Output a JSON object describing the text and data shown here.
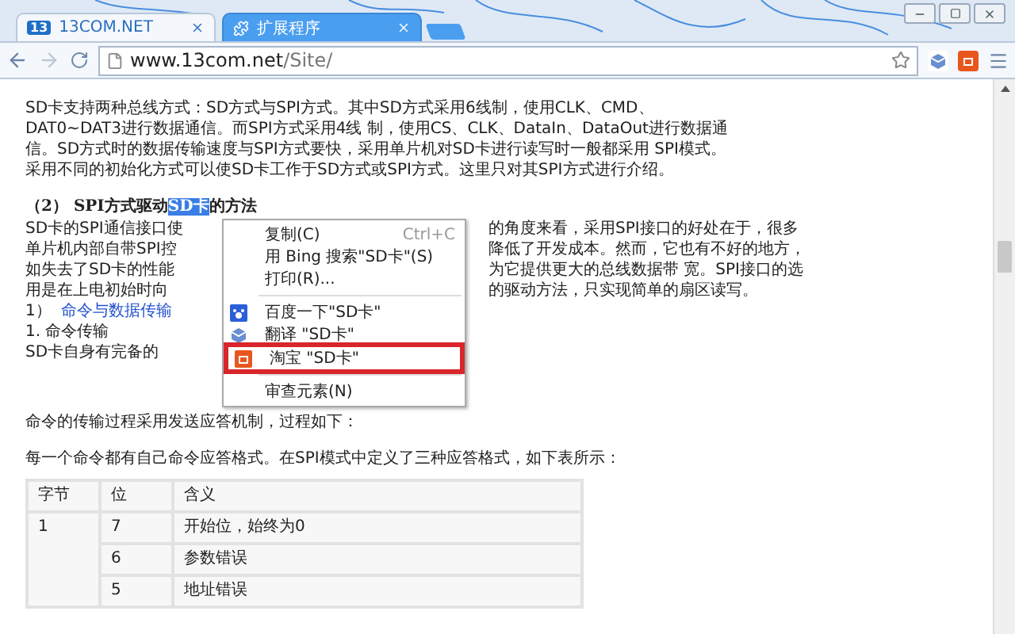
{
  "tabs": [
    {
      "title": "13COM.NET",
      "selected": true,
      "logo": "13"
    },
    {
      "title": "扩展程序",
      "selected": false
    }
  ],
  "address": {
    "host": "www.13com.net",
    "path": "/Site/"
  },
  "article": {
    "intro": "SD卡支持两种总线方式：SD方式与SPI方式。其中SD方式采用6线制，使用CLK、CMD、DAT0~DAT3进行数据通信。而SPI方式采用4线 制，使用CS、CLK、DataIn、DataOut进行数据通信。SD方式时的数据传输速度与SPI方式要快，采用单片机对SD卡进行读写时一般都采用 SPI模式。采用不同的初始化方式可以使SD卡工作于SD方式或SPI方式。这里只对其SPI方式进行介绍。",
    "heading": {
      "before": "（2） SPI方式驱动",
      "selection": "SD卡",
      "after": "的方法"
    },
    "split_lines": [
      {
        "left": "SD卡的SPI通信接口使",
        "right": "的角度来看，采用SPI接口的好处在于，很多"
      },
      {
        "left": "单片机内部自带SPI控",
        "right": "降低了开发成本。然而，它也有不好的地方，"
      },
      {
        "left": "如失去了SD卡的性能",
        "right": "为它提供更大的总线数据带 宽。SPI接口的选"
      },
      {
        "left": "用是在上电初始时向",
        "right": "的驱动方法，只实现简单的扇区读写。"
      }
    ],
    "section": {
      "number": "1）",
      "link": "命令与数据传输"
    },
    "subsection": "1. 命令传输",
    "partial_line": "SD卡自身有完备的",
    "line_1": "命令的传输过程采用发送应答机制，过程如下：",
    "line_2": "每一个命令都有自己命令应答格式。在SPI模式中定义了三种应答格式，如下表所示：",
    "table": {
      "columns": [
        "字节",
        "位",
        "含义"
      ],
      "group": "1",
      "rows": [
        {
          "bit": "7",
          "meaning": "开始位，始终为0"
        },
        {
          "bit": "6",
          "meaning": "参数错误"
        },
        {
          "bit": "5",
          "meaning": "地址错误"
        }
      ]
    }
  },
  "context_menu": [
    {
      "kind": "item",
      "label": "复制(C)",
      "shortcut": "Ctrl+C",
      "selected": false
    },
    {
      "kind": "item",
      "label": "用 Bing 搜索\"SD卡\"(S)",
      "selected": false
    },
    {
      "kind": "item",
      "label": "打印(R)...",
      "selected": false
    },
    {
      "kind": "separator"
    },
    {
      "kind": "item",
      "label": "百度一下\"SD卡\"",
      "selected": false
    },
    {
      "kind": "item",
      "label": "翻译 \"SD卡\"",
      "selected": false
    },
    {
      "kind": "item",
      "label": "淘宝 \"SD卡\"",
      "selected": true
    },
    {
      "kind": "separator"
    },
    {
      "kind": "item",
      "label": "审查元素(N)",
      "selected": false
    }
  ]
}
